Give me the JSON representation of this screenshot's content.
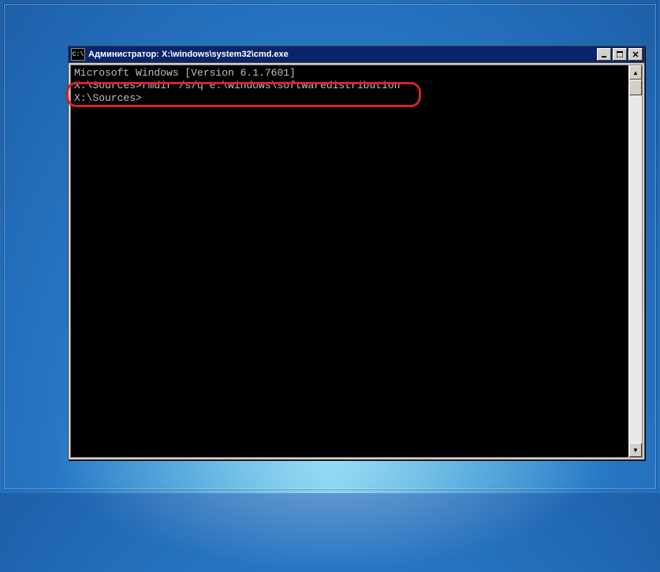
{
  "window": {
    "title": "Администратор: X:\\windows\\system32\\cmd.exe",
    "icon_label": "C:\\"
  },
  "console": {
    "line1": "Microsoft Windows [Version 6.1.7601]",
    "blank1": "",
    "line2_prompt": "X:\\Sources>",
    "line2_cmd": "rmdir /s/q e:\\windows\\softwaredistribution",
    "blank2": "",
    "line3_prompt": "X:\\Sources>"
  },
  "buttons": {
    "minimize": "_",
    "maximize": "□",
    "close": "✕"
  },
  "scrollbar": {
    "up": "▲",
    "down": "▼"
  }
}
